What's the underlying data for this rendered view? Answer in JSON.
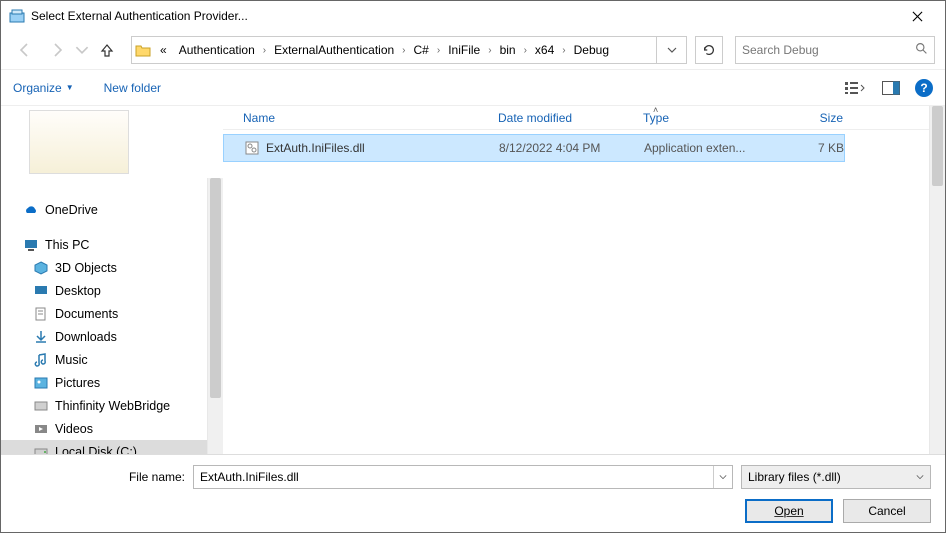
{
  "title": "Select External Authentication Provider...",
  "breadcrumb": [
    "«",
    "Authentication",
    "ExternalAuthentication",
    "C#",
    "IniFile",
    "bin",
    "x64",
    "Debug"
  ],
  "search": {
    "placeholder": "Search Debug"
  },
  "toolbar": {
    "organize": "Organize",
    "new_folder": "New folder"
  },
  "sidebar": {
    "onedrive": "OneDrive",
    "thispc": "This PC",
    "items": [
      {
        "label": "3D Objects",
        "icon": "3d"
      },
      {
        "label": "Desktop",
        "icon": "desktop"
      },
      {
        "label": "Documents",
        "icon": "doc"
      },
      {
        "label": "Downloads",
        "icon": "down"
      },
      {
        "label": "Music",
        "icon": "music"
      },
      {
        "label": "Pictures",
        "icon": "pic"
      },
      {
        "label": "Thinfinity WebBridge",
        "icon": "bridge"
      },
      {
        "label": "Videos",
        "icon": "video"
      },
      {
        "label": "Local Disk (C:)",
        "icon": "disk",
        "selected": true
      }
    ]
  },
  "list": {
    "headers": {
      "name": "Name",
      "date": "Date modified",
      "type": "Type",
      "size": "Size"
    },
    "rows": [
      {
        "name": "ExtAuth.IniFiles.dll",
        "date": "8/12/2022 4:04 PM",
        "type": "Application exten...",
        "size": "7 KB"
      }
    ]
  },
  "footer": {
    "filename_label": "File name:",
    "filename_value": "ExtAuth.IniFiles.dll",
    "filter": "Library files (*.dll)",
    "open": "Open",
    "cancel": "Cancel"
  }
}
